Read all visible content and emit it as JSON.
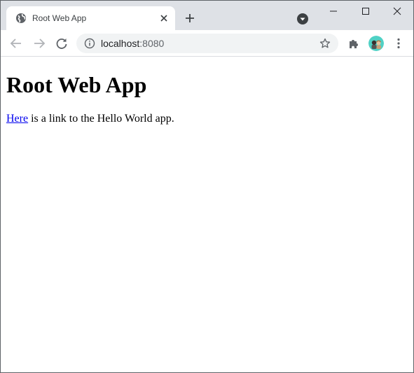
{
  "browser": {
    "tab": {
      "title": "Root Web App",
      "favicon": "globe-icon"
    },
    "address_bar": {
      "host": "localhost",
      "port": ":8080"
    },
    "colors": {
      "tabstrip": "#dee1e6",
      "omnibox": "#f1f3f4",
      "link": "#0000ee"
    }
  },
  "page": {
    "heading": "Root Web App",
    "link_text": "Here",
    "body_text": " is a link to the Hello World app."
  }
}
